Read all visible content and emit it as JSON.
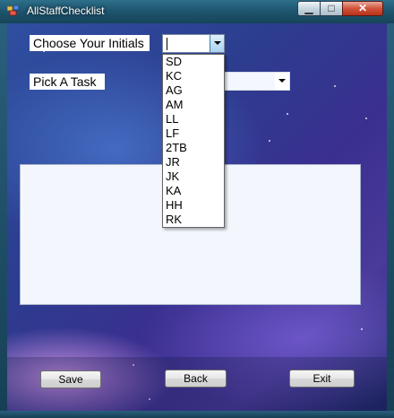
{
  "window": {
    "title": "AllStaffChecklist",
    "controls": {
      "minimize": "▁",
      "maximize": "□",
      "close": "✕"
    }
  },
  "form": {
    "initials_label": "Choose Your Initials",
    "initials_value": "",
    "initials_options": [
      "SD",
      "KC",
      "AG",
      "AM",
      "LL",
      "LF",
      "2TB",
      "JR",
      "JK",
      "KA",
      "HH",
      "RK"
    ],
    "task_label": "Pick A Task",
    "task_value": "",
    "notes_value": ""
  },
  "buttons": {
    "save": "Save",
    "back": "Back",
    "exit": "Exit"
  },
  "colors": {
    "titlebar": "#1f5670",
    "close_button": "#d2533c",
    "background": "#2c3d8f"
  }
}
